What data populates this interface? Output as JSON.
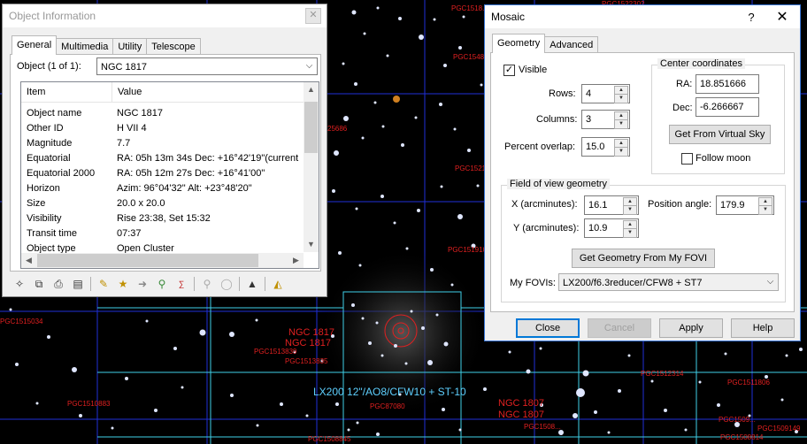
{
  "sky": {
    "labels": [
      "PGC1522302",
      "PGC1518...",
      "PGC1548...",
      "25686",
      "PGC1521...",
      "PGC151910",
      "PGC1515034",
      "PGC1513839",
      "PGC1513835",
      "PGC1512314",
      "PGC1511806",
      "PGC1510883",
      "PGC87080",
      "PGC1508845",
      "PGC1509...",
      "PGC1509149",
      "PGC1508814",
      "PGC1508..."
    ],
    "ngc_labels": [
      "NGC 1817",
      "NGC 1817",
      "NGC 1807",
      "NGC 1807"
    ],
    "fov_label": "LX200 12\"/AO8/CFW10 + ST-10"
  },
  "object_window": {
    "title": "Object Information",
    "close_glyph": "✕",
    "tabs": [
      "General",
      "Multimedia",
      "Utility",
      "Telescope"
    ],
    "object_label": "Object (1 of 1):",
    "object_value": "NGC 1817",
    "columns": [
      "Item",
      "Value"
    ],
    "rows": [
      {
        "item": "Object name",
        "value": "NGC 1817"
      },
      {
        "item": "Other ID",
        "value": "H VII 4"
      },
      {
        "item": "Magnitude",
        "value": "7.7"
      },
      {
        "item": "Equatorial",
        "value": "RA: 05h 13m 34s   Dec: +16°42'19\"(current"
      },
      {
        "item": "Equatorial 2000",
        "value": "RA: 05h 12m 27s   Dec: +16°41'00\""
      },
      {
        "item": "Horizon",
        "value": "Azim: 96°04'32\"   Alt: +23°48'20\""
      },
      {
        "item": "Size",
        "value": "20.0 x 20.0"
      },
      {
        "item": "Visibility",
        "value": "Rise 23:38,  Set 15:32"
      },
      {
        "item": "Transit time",
        "value": "07:37"
      },
      {
        "item": "Object type",
        "value": "Open Cluster"
      }
    ],
    "toolbar_icons": [
      "crosshair-icon",
      "copy-icon",
      "print-icon",
      "book-icon",
      "ruler-pencil-icon",
      "star-chart-icon",
      "pointer-arrow-icon",
      "telescope-icon",
      "abc-icon",
      "telescope-disabled-icon",
      "camera-disabled-icon",
      "eject-icon",
      "open-folder-icon"
    ]
  },
  "mosaic": {
    "title": "Mosaic",
    "help_glyph": "?",
    "close_glyph": "✕",
    "tabs": [
      "Geometry",
      "Advanced"
    ],
    "visible_label": "Visible",
    "visible_checked": true,
    "rows_label": "Rows:",
    "rows_value": "4",
    "columns_label": "Columns:",
    "columns_value": "3",
    "overlap_label": "Percent overlap:",
    "overlap_value": "15.0",
    "center_title": "Center coordinates",
    "ra_label": "RA:",
    "ra_value": "18.851666",
    "dec_label": "Dec:",
    "dec_value": "-6.266667",
    "get_from_sky": "Get From Virtual Sky",
    "follow_moon": "Follow moon",
    "follow_moon_checked": false,
    "fov_title": "Field of view geometry",
    "x_label": "X (arcminutes):",
    "x_value": "16.1",
    "y_label": "Y (arcminutes):",
    "y_value": "10.9",
    "pa_label": "Position angle:",
    "pa_value": "179.9",
    "get_geometry": "Get Geometry From My FOVI",
    "my_fovis_label": "My FOVIs:",
    "my_fovis_value": "LX200/f6.3reducer/CFW8 + ST7",
    "buttons": {
      "close": "Close",
      "cancel": "Cancel",
      "apply": "Apply",
      "help": "Help"
    }
  }
}
